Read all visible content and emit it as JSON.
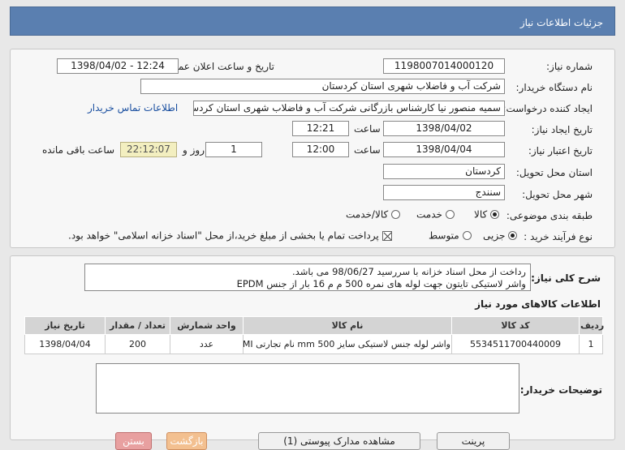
{
  "window": {
    "title": "جزئیات اطلاعات نیاز"
  },
  "form": {
    "need_number_label": "شماره نیاز:",
    "need_number": "1198007014000120",
    "announce_label": "تاریخ و ساعت اعلان عمومی:",
    "announce_value": "1398/04/02 - 12:24",
    "buyer_org_label": "نام دستگاه خریدار:",
    "buyer_org": "شرکت آب و فاضلاب شهری استان کردستان",
    "requester_label": "ایجاد کننده درخواست:",
    "requester": "سمیه منصور نیا کارشناس بازرگانی شرکت آب و فاضلاب شهری استان کردستان",
    "contact_link": "اطلاعات تماس خریدار",
    "created_label": "تاریخ ایجاد نیاز:",
    "created_date": "1398/04/02",
    "time_label": "ساعت",
    "created_time": "12:21",
    "validity_label": "تاریخ اعتبار نیاز:",
    "validity_date": "1398/04/04",
    "validity_time": "12:00",
    "days_value": "1",
    "days_label": "روز و",
    "remaining_time": "22:12:07",
    "remaining_label": "ساعت باقی مانده",
    "province_label": "استان محل تحویل:",
    "province": "کردستان",
    "city_label": "شهر محل تحویل:",
    "city": "سنندج",
    "category_label": "طبقه بندی موضوعی:",
    "category_options": [
      {
        "label": "کالا",
        "selected": true
      },
      {
        "label": "خدمت",
        "selected": false
      },
      {
        "label": "کالا/خدمت",
        "selected": false
      }
    ],
    "process_label": "نوع فرآیند خرید :",
    "process_options": [
      {
        "label": "جزیی",
        "selected": true
      },
      {
        "label": "متوسط",
        "selected": false
      }
    ],
    "treasury_note": "پرداخت تمام یا بخشی از مبلغ خرید،از محل \"اسناد خزانه اسلامی\" خواهد بود."
  },
  "description": {
    "label": "شرح کلی نیاز:",
    "line1": "رداخت از محل اسناد خزانه با سررسید 98/06/27 می باشد.",
    "line2": "واشر لاستیکی تایتون جهت لوله های نمره 500 م م 16 بار از جنس EPDM"
  },
  "items": {
    "section_title": "اطلاعات کالاهای مورد نیاز",
    "headers": [
      "ردیف",
      "کد کالا",
      "نام کالا",
      "واحد شمارش",
      "تعداد / مقدار",
      "تاریخ نیاز"
    ],
    "rows": [
      [
        "1",
        "5534511700440009",
        "واشر لوله جنس لاستیکی سایز 500 mm نام تجارتی LMI",
        "عدد",
        "200",
        "1398/04/04"
      ]
    ]
  },
  "buyer_notes": {
    "label": "توضیحات خریدار:"
  },
  "buttons": {
    "print": "پرینت",
    "view_docs": "مشاهده مدارک پیوستی (1)",
    "back": "بازگشت",
    "close": "بستن"
  },
  "colors": {
    "titlebar": "#5a7fb0",
    "link": "#1a4fa0",
    "remaining_bg": "#f3efc0"
  }
}
